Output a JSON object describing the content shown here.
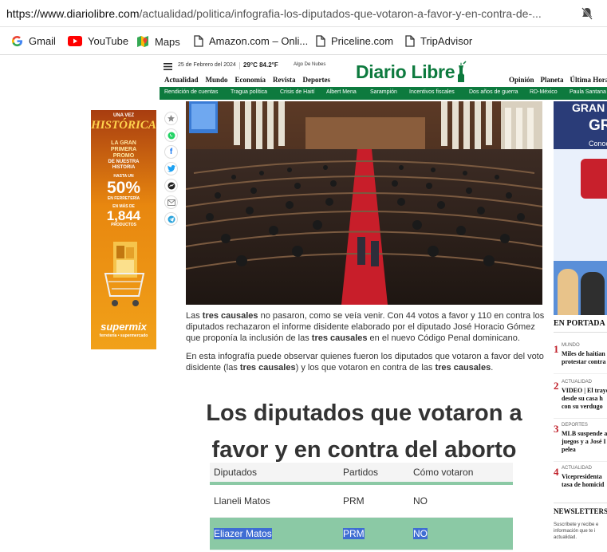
{
  "browser": {
    "url_domain": "https://www.diariolibre.com",
    "url_path": "/actualidad/politica/infografia-los-diputados-que-votaron-a-favor-y-en-contra-de-...",
    "bookmarks": [
      {
        "label": "Gmail",
        "icon": "google-icon"
      },
      {
        "label": "YouTube",
        "icon": "youtube-icon"
      },
      {
        "label": "Maps",
        "icon": "maps-icon"
      },
      {
        "label": "Amazon.com – Onli...",
        "icon": "page-icon"
      },
      {
        "label": "Priceline.com",
        "icon": "page-icon"
      },
      {
        "label": "TripAdvisor",
        "icon": "page-icon"
      }
    ]
  },
  "site": {
    "date": "25 de Febrero del 2024",
    "weather": "29°C 84.2°F",
    "weather_desc": "Algo De Nubes",
    "logo": "Diario Libre",
    "nav_left": [
      "Actualidad",
      "Mundo",
      "Economía",
      "Revista",
      "Deportes"
    ],
    "nav_right": [
      "Opinión",
      "Planeta",
      "Última Hora"
    ],
    "green_links": [
      "Rendición de cuentas",
      "Tragua política",
      "Crisis de Haití",
      "Albert Mena",
      "Sarampión",
      "Incentivos fiscales",
      "Dos años de guerra",
      "RD-México",
      "Paula Santana"
    ]
  },
  "share": [
    "star-icon",
    "whatsapp-icon",
    "facebook-icon",
    "twitter-icon",
    "messenger-icon",
    "email-icon",
    "telegram-icon"
  ],
  "ad_left": {
    "top": "UNA VEZ",
    "brand": "HISTÓRICA",
    "l1": "LA GRAN",
    "l2": "PRIMERA",
    "l3": "PROMO",
    "l4": "DE NUESTRA",
    "l5": "HISTORIA",
    "upto": "HASTA UN",
    "pct": "50%",
    "pct_sub": "EN FERRETERÍA",
    "more": "EN MÁS DE",
    "count": "1,844",
    "count_sub": "PRODUCTOS",
    "store": "supermix",
    "store_sub": "ferretería • supermercado"
  },
  "article": {
    "p1_a": "Las ",
    "p1_b": "tres causales",
    "p1_c": " no pasaron, como se veía venir. Con 44 votos a favor y 110 en contra los diputados rechazaron el informe disidente elaborado por el diputado José Horacio Gómez que proponía la inclusión de las ",
    "p1_d": "tres causales",
    "p1_e": " en el nuevo Código Penal dominicano.",
    "p2_a": "En esta infografía puede observar quienes fueron los diputados que votaron a favor del voto disidente (las ",
    "p2_b": "tres causales",
    "p2_c": ") y los que votaron en contra de las ",
    "p2_d": "tres causales",
    "p2_e": "."
  },
  "infographic": {
    "title": "Los diputados que votaron a favor y en contra del aborto",
    "headers": [
      "Diputados",
      "Partidos",
      "Cómo votaron"
    ],
    "rows": [
      {
        "name": "Llaneli Matos",
        "party": "PRM",
        "vote": "NO"
      },
      {
        "name": "Eliazer Matos",
        "party": "PRM",
        "vote": "NO"
      }
    ],
    "colors": {
      "row_green": "#8bc9a5",
      "highlight": "#3f6dd3"
    }
  },
  "right_ad": {
    "l1": "GRAN C",
    "l2": "GR",
    "l3": "Conoc"
  },
  "portada": {
    "title": "EN PORTADA",
    "items": [
      {
        "num": "1",
        "cat": "MUNDO",
        "h1": "Miles de haitian",
        "h2": "protestar contra"
      },
      {
        "num": "2",
        "cat": "ACTUALIDAD",
        "h1": "VIDEO | El trayec",
        "h2": "desde su casa h",
        "h3": "con su verdugo"
      },
      {
        "num": "3",
        "cat": "DEPORTES",
        "h1": "MLB suspende a",
        "h2": "juegos y a José I",
        "h3": "pelea"
      },
      {
        "num": "4",
        "cat": "ACTUALIDAD",
        "h1": "Vicepresidenta",
        "h2": "tasa de homicid"
      }
    ]
  },
  "newsletter": {
    "title": "NEWSLETTERS",
    "l1": "Suscríbete y recibe e",
    "l2": "información que te i",
    "l3": "actualidad."
  },
  "colors": {
    "brand_green": "#0d7a3e",
    "rank_red": "#c0202a"
  }
}
